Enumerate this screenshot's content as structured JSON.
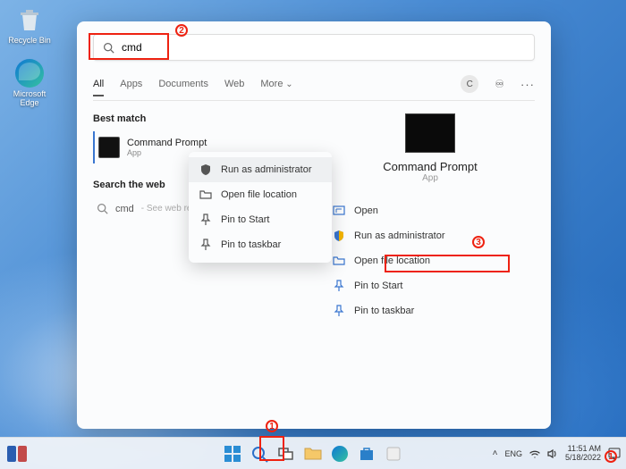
{
  "desktop": {
    "recycle_bin": "Recycle Bin",
    "edge": "Microsoft Edge"
  },
  "search": {
    "query": "cmd",
    "tabs": {
      "all": "All",
      "apps": "Apps",
      "documents": "Documents",
      "web": "Web",
      "more": "More"
    },
    "user_initial": "C",
    "best_match_header": "Best match",
    "top_result": {
      "title": "Command Prompt",
      "subtitle": "App"
    },
    "web_header": "Search the web",
    "web_result": {
      "term": "cmd",
      "suffix": " - See web results"
    },
    "ctx": {
      "run_admin": "Run as administrator",
      "open_loc": "Open file location",
      "pin_start": "Pin to Start",
      "pin_taskbar": "Pin to taskbar"
    },
    "detail": {
      "name": "Command Prompt",
      "sub": "App",
      "open": "Open",
      "run_admin": "Run as administrator",
      "open_loc": "Open file location",
      "pin_start": "Pin to Start",
      "pin_taskbar": "Pin to taskbar"
    }
  },
  "taskbar": {
    "lang": "ENG",
    "time": "11:51 AM",
    "date": "5/18/2022"
  },
  "annotations": {
    "a1": "1",
    "a2": "2",
    "a3": "3"
  }
}
